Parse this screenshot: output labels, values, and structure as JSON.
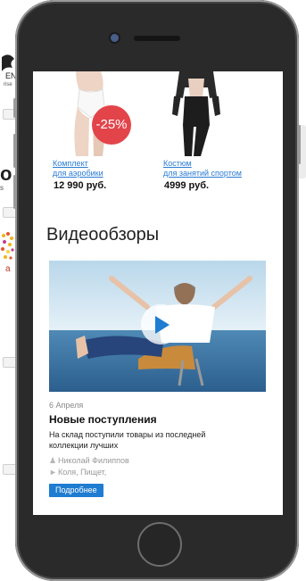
{
  "background": {
    "logo_text": "EN",
    "logo_sub": "rise",
    "letter_o": "o",
    "letter_small": "s",
    "letter_a": "a"
  },
  "products": [
    {
      "link_line1": "Комплект",
      "link_line2": "для аэробики",
      "price": "12 990 руб.",
      "badge": "-25%"
    },
    {
      "link_line1": "Костюм",
      "link_line2": "для занятий спортом",
      "price": "4999 руб."
    }
  ],
  "section_title": "Видеообзоры",
  "news": {
    "date": "6 Апреля",
    "title": "Новые поступления",
    "desc": "На склад поступили товары из последней коллекции лучших",
    "author": "Николай Филиппов",
    "tags": "Коля, Пищет,",
    "button": "Подробнее"
  },
  "colors": {
    "accent": "#1e7cd1",
    "link": "#2a7bd3",
    "sale": "#e2444a"
  },
  "icons": {
    "play": "play-icon",
    "author": "person-icon",
    "tags": "tag-icon"
  }
}
